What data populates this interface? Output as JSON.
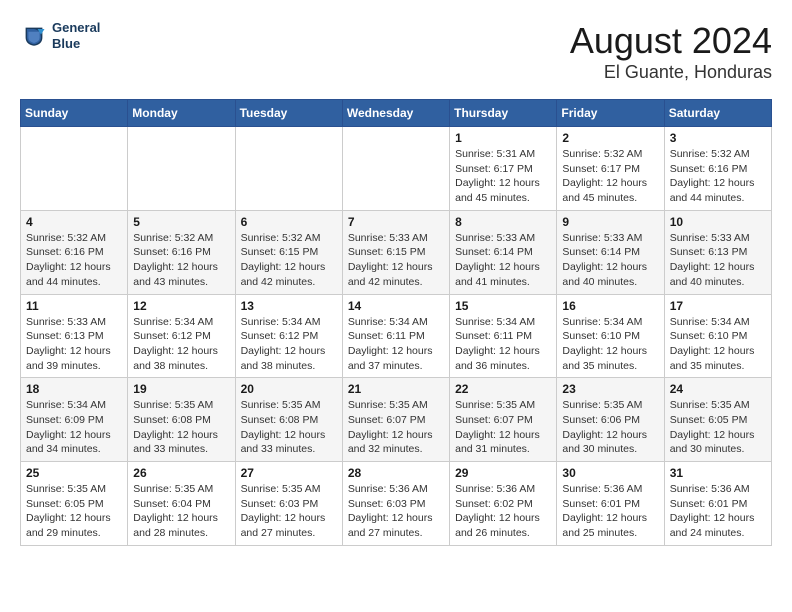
{
  "logo": {
    "line1": "General",
    "line2": "Blue"
  },
  "title": "August 2024",
  "subtitle": "El Guante, Honduras",
  "days_of_week": [
    "Sunday",
    "Monday",
    "Tuesday",
    "Wednesday",
    "Thursday",
    "Friday",
    "Saturday"
  ],
  "weeks": [
    [
      {
        "day": "",
        "detail": ""
      },
      {
        "day": "",
        "detail": ""
      },
      {
        "day": "",
        "detail": ""
      },
      {
        "day": "",
        "detail": ""
      },
      {
        "day": "1",
        "detail": "Sunrise: 5:31 AM\nSunset: 6:17 PM\nDaylight: 12 hours\nand 45 minutes."
      },
      {
        "day": "2",
        "detail": "Sunrise: 5:32 AM\nSunset: 6:17 PM\nDaylight: 12 hours\nand 45 minutes."
      },
      {
        "day": "3",
        "detail": "Sunrise: 5:32 AM\nSunset: 6:16 PM\nDaylight: 12 hours\nand 44 minutes."
      }
    ],
    [
      {
        "day": "4",
        "detail": "Sunrise: 5:32 AM\nSunset: 6:16 PM\nDaylight: 12 hours\nand 44 minutes."
      },
      {
        "day": "5",
        "detail": "Sunrise: 5:32 AM\nSunset: 6:16 PM\nDaylight: 12 hours\nand 43 minutes."
      },
      {
        "day": "6",
        "detail": "Sunrise: 5:32 AM\nSunset: 6:15 PM\nDaylight: 12 hours\nand 42 minutes."
      },
      {
        "day": "7",
        "detail": "Sunrise: 5:33 AM\nSunset: 6:15 PM\nDaylight: 12 hours\nand 42 minutes."
      },
      {
        "day": "8",
        "detail": "Sunrise: 5:33 AM\nSunset: 6:14 PM\nDaylight: 12 hours\nand 41 minutes."
      },
      {
        "day": "9",
        "detail": "Sunrise: 5:33 AM\nSunset: 6:14 PM\nDaylight: 12 hours\nand 40 minutes."
      },
      {
        "day": "10",
        "detail": "Sunrise: 5:33 AM\nSunset: 6:13 PM\nDaylight: 12 hours\nand 40 minutes."
      }
    ],
    [
      {
        "day": "11",
        "detail": "Sunrise: 5:33 AM\nSunset: 6:13 PM\nDaylight: 12 hours\nand 39 minutes."
      },
      {
        "day": "12",
        "detail": "Sunrise: 5:34 AM\nSunset: 6:12 PM\nDaylight: 12 hours\nand 38 minutes."
      },
      {
        "day": "13",
        "detail": "Sunrise: 5:34 AM\nSunset: 6:12 PM\nDaylight: 12 hours\nand 38 minutes."
      },
      {
        "day": "14",
        "detail": "Sunrise: 5:34 AM\nSunset: 6:11 PM\nDaylight: 12 hours\nand 37 minutes."
      },
      {
        "day": "15",
        "detail": "Sunrise: 5:34 AM\nSunset: 6:11 PM\nDaylight: 12 hours\nand 36 minutes."
      },
      {
        "day": "16",
        "detail": "Sunrise: 5:34 AM\nSunset: 6:10 PM\nDaylight: 12 hours\nand 35 minutes."
      },
      {
        "day": "17",
        "detail": "Sunrise: 5:34 AM\nSunset: 6:10 PM\nDaylight: 12 hours\nand 35 minutes."
      }
    ],
    [
      {
        "day": "18",
        "detail": "Sunrise: 5:34 AM\nSunset: 6:09 PM\nDaylight: 12 hours\nand 34 minutes."
      },
      {
        "day": "19",
        "detail": "Sunrise: 5:35 AM\nSunset: 6:08 PM\nDaylight: 12 hours\nand 33 minutes."
      },
      {
        "day": "20",
        "detail": "Sunrise: 5:35 AM\nSunset: 6:08 PM\nDaylight: 12 hours\nand 33 minutes."
      },
      {
        "day": "21",
        "detail": "Sunrise: 5:35 AM\nSunset: 6:07 PM\nDaylight: 12 hours\nand 32 minutes."
      },
      {
        "day": "22",
        "detail": "Sunrise: 5:35 AM\nSunset: 6:07 PM\nDaylight: 12 hours\nand 31 minutes."
      },
      {
        "day": "23",
        "detail": "Sunrise: 5:35 AM\nSunset: 6:06 PM\nDaylight: 12 hours\nand 30 minutes."
      },
      {
        "day": "24",
        "detail": "Sunrise: 5:35 AM\nSunset: 6:05 PM\nDaylight: 12 hours\nand 30 minutes."
      }
    ],
    [
      {
        "day": "25",
        "detail": "Sunrise: 5:35 AM\nSunset: 6:05 PM\nDaylight: 12 hours\nand 29 minutes."
      },
      {
        "day": "26",
        "detail": "Sunrise: 5:35 AM\nSunset: 6:04 PM\nDaylight: 12 hours\nand 28 minutes."
      },
      {
        "day": "27",
        "detail": "Sunrise: 5:35 AM\nSunset: 6:03 PM\nDaylight: 12 hours\nand 27 minutes."
      },
      {
        "day": "28",
        "detail": "Sunrise: 5:36 AM\nSunset: 6:03 PM\nDaylight: 12 hours\nand 27 minutes."
      },
      {
        "day": "29",
        "detail": "Sunrise: 5:36 AM\nSunset: 6:02 PM\nDaylight: 12 hours\nand 26 minutes."
      },
      {
        "day": "30",
        "detail": "Sunrise: 5:36 AM\nSunset: 6:01 PM\nDaylight: 12 hours\nand 25 minutes."
      },
      {
        "day": "31",
        "detail": "Sunrise: 5:36 AM\nSunset: 6:01 PM\nDaylight: 12 hours\nand 24 minutes."
      }
    ]
  ]
}
